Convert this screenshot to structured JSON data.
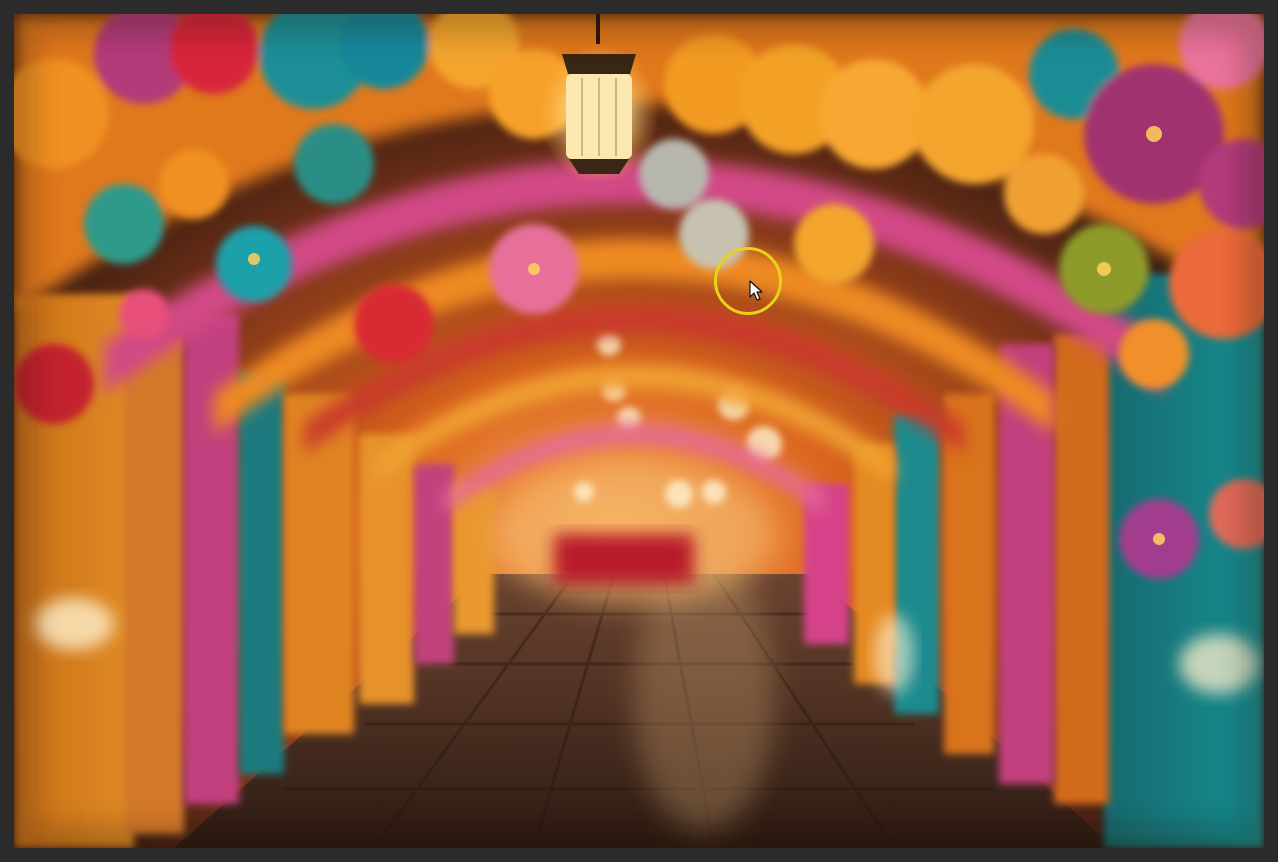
{
  "viewer": {
    "background_color": "#2b2b2b",
    "image_subject_icon": "photo-icon"
  },
  "image": {
    "palette": {
      "orange": "#f08a1c",
      "teal": "#1f8a8e",
      "magenta": "#c0407e",
      "pink": "#e46fa2",
      "red": "#d2262e",
      "floor": "#4a2e1e",
      "lantern_glow": "#fff2c0"
    }
  },
  "cursor": {
    "highlight_color": "#e8d21a",
    "icon": "pointer-arrow-icon"
  }
}
